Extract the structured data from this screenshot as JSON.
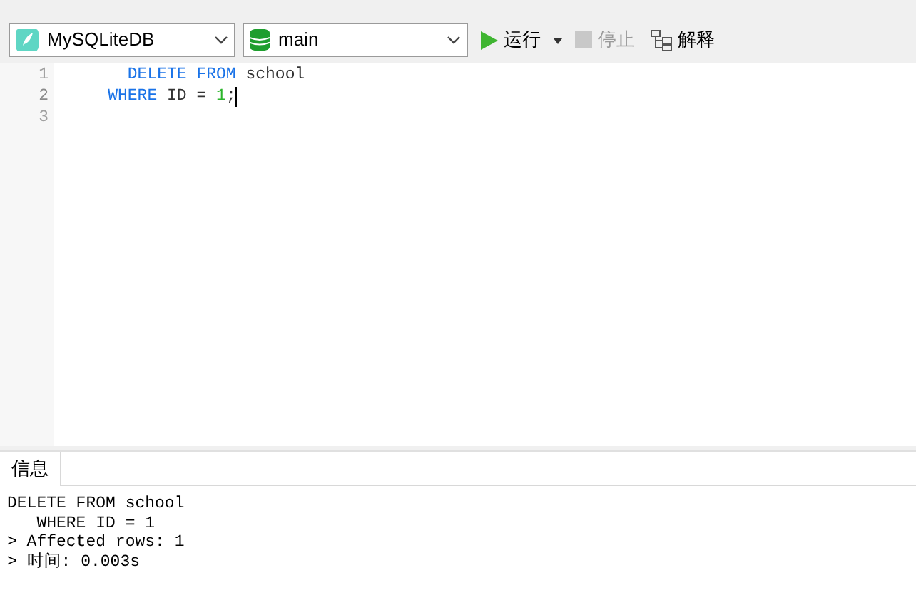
{
  "toolbar": {
    "connection": {
      "value": "MySQLiteDB"
    },
    "database": {
      "value": "main"
    },
    "run": {
      "label": "运行",
      "disabled": false
    },
    "stop": {
      "label": "停止",
      "disabled": true
    },
    "explain": {
      "label": "解释",
      "disabled": false
    }
  },
  "editor": {
    "lines": [
      {
        "number": "1",
        "cursor": false,
        "tokens": [
          {
            "kind": "keyword",
            "text": "      DELETE FROM"
          },
          {
            "kind": "plain",
            "text": " school"
          }
        ]
      },
      {
        "number": "2",
        "cursor": true,
        "tokens": [
          {
            "kind": "keyword",
            "text": "    WHERE"
          },
          {
            "kind": "plain",
            "text": " ID = "
          },
          {
            "kind": "number",
            "text": "1"
          },
          {
            "kind": "plain",
            "text": ";"
          }
        ]
      },
      {
        "number": "3",
        "cursor": false
      }
    ]
  },
  "results": {
    "tabs": [
      {
        "label": "信息",
        "selected": true
      }
    ],
    "lines": [
      "DELETE FROM school",
      "   WHERE ID = 1",
      "> Affected rows: 1",
      "> 时间: 0.003s"
    ]
  }
}
